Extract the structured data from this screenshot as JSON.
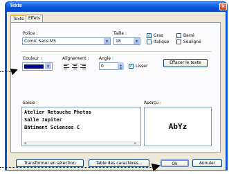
{
  "window": {
    "title": "Texte",
    "close_glyph": "×"
  },
  "tabs": [
    "Texte",
    "Effets"
  ],
  "font": {
    "label": "Police :",
    "value": "Comic Sans MS"
  },
  "size": {
    "label": "Taille :",
    "value": "18"
  },
  "styles": {
    "bold": {
      "label": "Gras",
      "checked": true
    },
    "italic": {
      "label": "Italique",
      "checked": false
    },
    "strike": {
      "label": "Barré",
      "checked": false
    },
    "underline": {
      "label": "Souligné",
      "checked": false
    }
  },
  "color": {
    "label": "Couleur :",
    "value": "#00008b"
  },
  "alignment": {
    "label": "Alignement :"
  },
  "angle": {
    "label": "Angle :",
    "value": "0"
  },
  "smooth": {
    "label": "Lisser",
    "checked": true
  },
  "clear_button": "Effacer le texte",
  "input": {
    "label": "Saisie :",
    "lines": [
      "Atelier Retouche Photos",
      "Salle Jupiter",
      "Bâtiment Sciences C"
    ]
  },
  "preview": {
    "label": "Aperçu :",
    "text": "AbYz"
  },
  "footer": {
    "transform_button": "Transformer en sélection",
    "chars_button": "Table des caractères...",
    "ok_button": "Ok",
    "cancel_button": "Annuler"
  }
}
